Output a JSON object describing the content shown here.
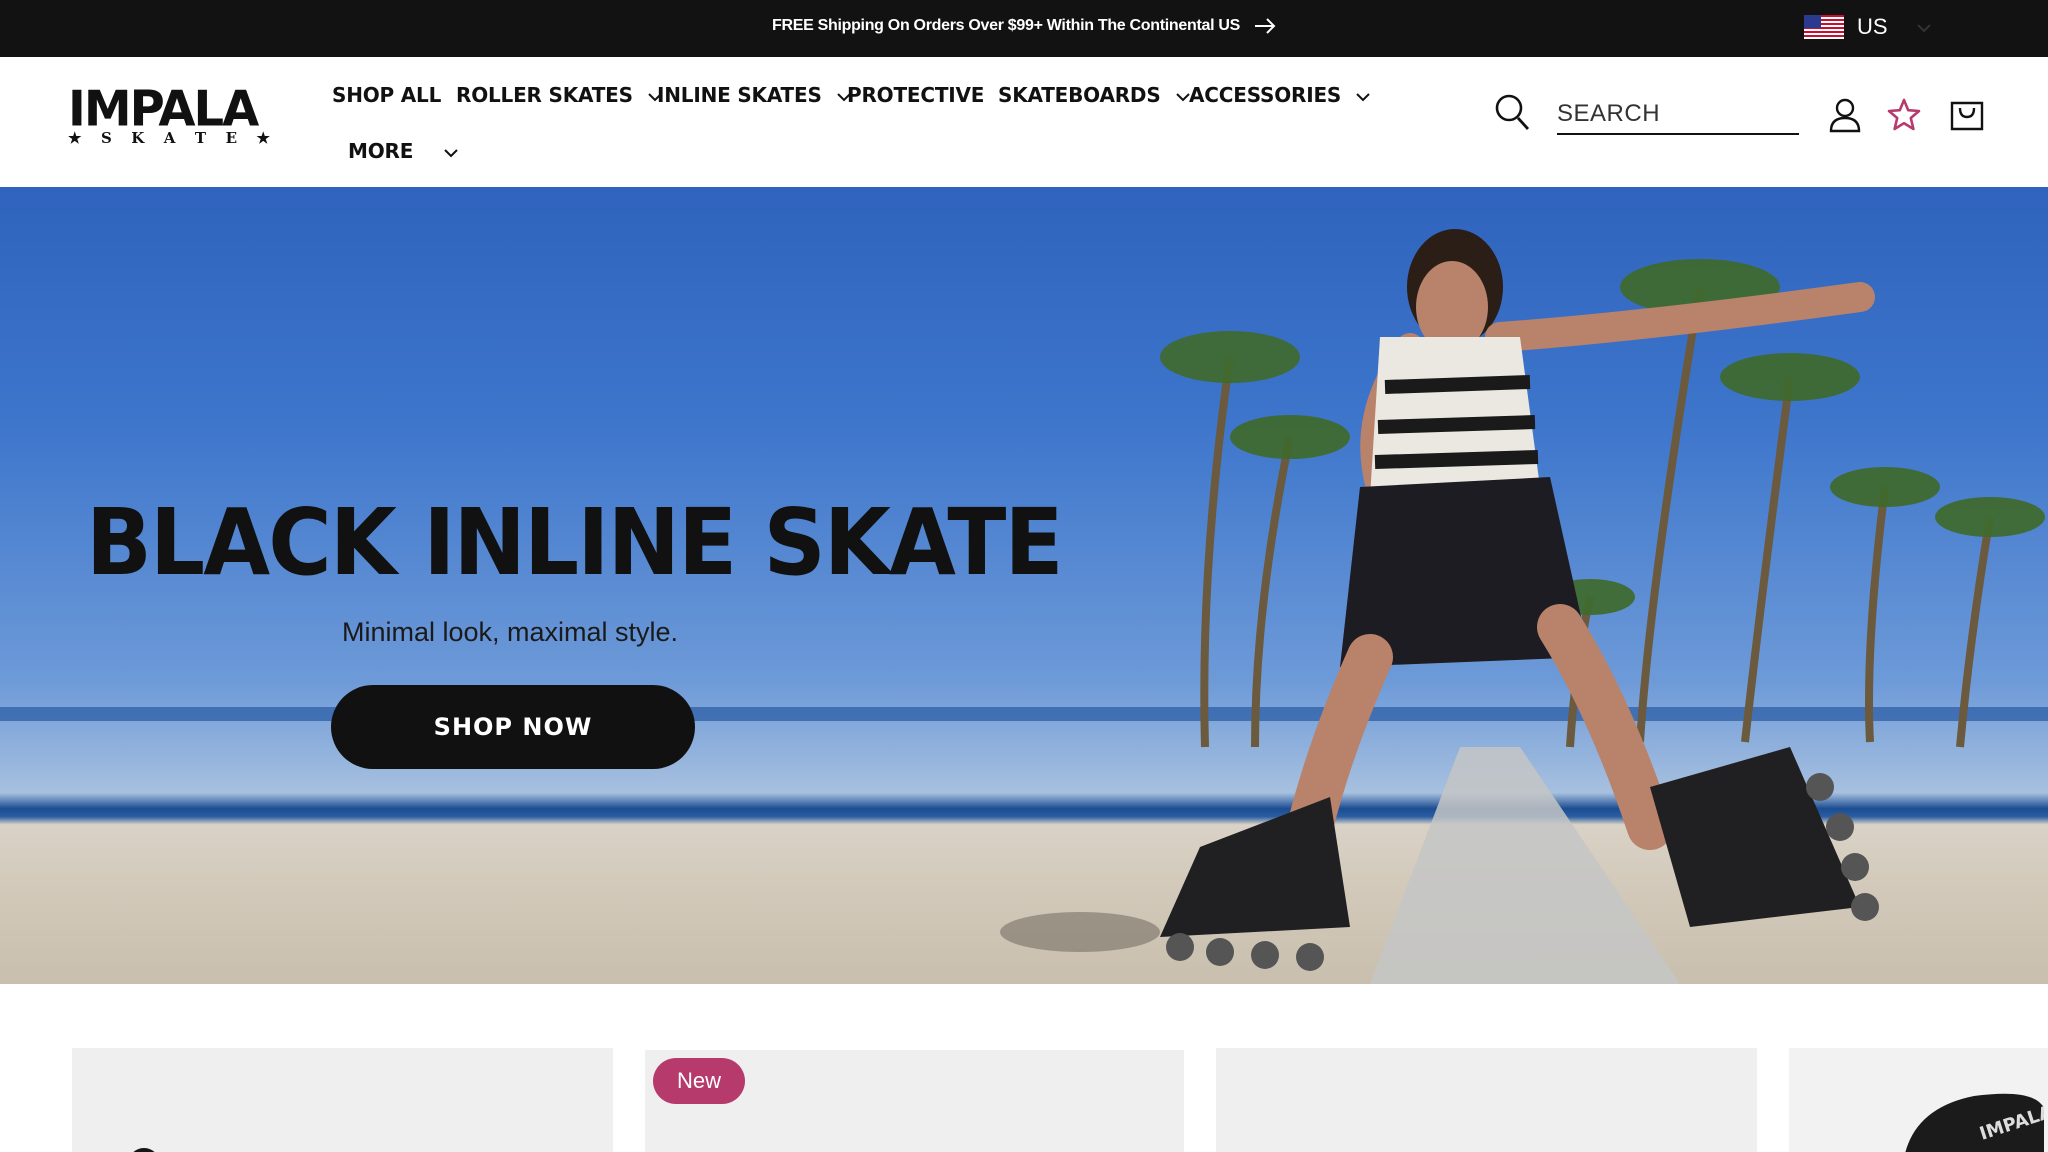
{
  "announcement": {
    "text": "FREE Shipping On Orders Over $99+ Within The Continental US",
    "icon": "arrow-right-icon"
  },
  "locale": {
    "label": "US",
    "flag": "us-flag-icon"
  },
  "brand": {
    "logo_word": "IMPALA",
    "logo_sub": [
      "★",
      "S",
      "K",
      "A",
      "T",
      "E",
      "★"
    ]
  },
  "nav": {
    "items": [
      {
        "label": "SHOP ALL",
        "has_dropdown": false
      },
      {
        "label": "ROLLER SKATES",
        "has_dropdown": true
      },
      {
        "label": "INLINE SKATES",
        "has_dropdown": true
      },
      {
        "label": "PROTECTIVE",
        "has_dropdown": false
      },
      {
        "label": "SKATEBOARDS",
        "has_dropdown": true
      },
      {
        "label": "ACCESSORIES",
        "has_dropdown": true
      },
      {
        "label": "MORE",
        "has_dropdown": true
      }
    ]
  },
  "search": {
    "placeholder": "SEARCH",
    "value": ""
  },
  "header_icons": [
    "search-icon",
    "account-icon",
    "wishlist-star-icon",
    "cart-icon"
  ],
  "hero": {
    "title": "BLACK INLINE SKATE",
    "subtitle": "Minimal look, maximal style.",
    "cta_label": "SHOP NOW"
  },
  "products": {
    "cards": [
      {
        "badge": ""
      },
      {
        "badge": "New"
      },
      {
        "badge": ""
      },
      {
        "badge": ""
      }
    ]
  },
  "colors": {
    "announcement_bg": "#121212",
    "badge_bg": "#b63a6c",
    "cta_bg": "#111111",
    "card_bg": "#efefef"
  }
}
